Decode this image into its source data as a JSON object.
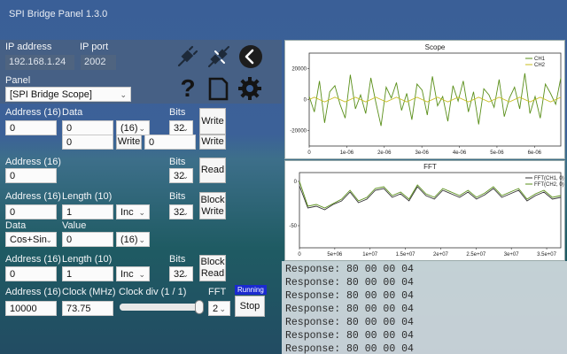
{
  "app": {
    "title": "SPI Bridge Panel 1.3.0"
  },
  "connection": {
    "ip_address_label": "IP address",
    "ip_address_value": "192.168.1.24",
    "ip_port_label": "IP port",
    "ip_port_value": "2002",
    "icons": [
      "plug-disconnected-icon",
      "plug-connect-icon",
      "back-icon"
    ]
  },
  "panel": {
    "label": "Panel",
    "selected": "[SPI Bridge Scope]",
    "icons": [
      "help-icon",
      "document-icon",
      "settings-icon"
    ]
  },
  "write_section": {
    "address_label": "Address (16)",
    "address_value": "0",
    "data_label": "Data",
    "data_value": "0",
    "data_format": "(16)",
    "bits_label": "Bits",
    "bits_value": "32",
    "write_button": "Write",
    "row2_data_value": "0",
    "row2_write_button": "Write",
    "row2_value": "0",
    "row2_write_button2": "Write"
  },
  "read_section": {
    "address_label": "Address (16)",
    "address_value": "0",
    "bits_label": "Bits",
    "bits_value": "32",
    "read_button": "Read"
  },
  "block_write_section": {
    "address_label": "Address (16)",
    "address_value": "0",
    "length_label": "Length (10)",
    "length_value": "1",
    "mode": "Inc",
    "bits_label": "Bits",
    "bits_value": "32",
    "button": "Block Write",
    "data_label": "Data",
    "data_source": "Cos+Sin",
    "value_label": "Value",
    "value_value": "0",
    "value_format": "(16)"
  },
  "block_read_section": {
    "address_label": "Address (16)",
    "address_value": "0",
    "length_label": "Length (10)",
    "length_value": "1",
    "mode": "Inc",
    "bits_label": "Bits",
    "bits_value": "32",
    "button": "Block Read"
  },
  "scope_section": {
    "address_label": "Address (16)",
    "address_value": "10000",
    "clock_label": "Clock (MHz)",
    "clock_value": "73.75",
    "clock_div_label": "Clock div (1 / 1)",
    "clock_div_level": 1.0,
    "fft_label": "FFT",
    "fft_value": "2",
    "status": "Running",
    "stop_button": "Stop"
  },
  "chart_data": [
    {
      "type": "line",
      "title": "Scope",
      "x_ticks": [
        "0",
        "1e-06",
        "2e-06",
        "3e-06",
        "4e-06",
        "5e-06",
        "6e-06"
      ],
      "y_ticks": [
        "20000",
        "0",
        "-20000"
      ],
      "xlim": [
        0,
        6.7e-06
      ],
      "ylim": [
        -30000,
        30000
      ],
      "series": [
        {
          "name": "CH1",
          "color": "#5a8f1a",
          "values": [
            2000,
            -8000,
            12000,
            -15000,
            5000,
            9000,
            -3000,
            -12000,
            16000,
            -6000,
            3000,
            -9000,
            14000,
            -2000,
            -17000,
            8000,
            1000,
            11000,
            -7000,
            4000,
            -13000,
            10000,
            6000,
            -10000,
            15000,
            -4000,
            2000,
            -14000,
            9000,
            -1000,
            12000,
            -8000,
            5000,
            -16000,
            7000,
            3000,
            -5000,
            13000,
            -11000,
            1000,
            8000,
            -6000,
            17000,
            -9000,
            2000,
            -12000,
            10000,
            4000,
            -3000,
            14000
          ]
        },
        {
          "name": "CH2",
          "color": "#c8bd1e",
          "values": [
            0,
            1500,
            0,
            -1500,
            0,
            1500,
            0,
            -1500,
            0,
            1500,
            0,
            -1500,
            0,
            1500,
            0,
            -1500,
            0,
            1500,
            0,
            -1500,
            0,
            1500,
            0,
            -1500,
            0,
            1500,
            0,
            -1500,
            0,
            1500,
            0,
            -1500,
            0,
            1500,
            0,
            -1500,
            0,
            1500,
            0,
            -1500,
            0,
            1500,
            0,
            -1500,
            0,
            1500,
            0,
            -1500,
            0,
            1500
          ]
        }
      ],
      "legend": "top-right"
    },
    {
      "type": "line",
      "title": "FFT",
      "x_ticks": [
        "0",
        "5e+06",
        "1e+07",
        "1.5e+07",
        "2e+07",
        "2.5e+07",
        "3e+07",
        "3.5e+07"
      ],
      "y_ticks": [
        "0",
        "-50"
      ],
      "xlim": [
        0,
        37000000.0
      ],
      "ylim": [
        -75,
        10
      ],
      "series": [
        {
          "name": "FFT(CH1, 0)",
          "color": "#333333",
          "values": [
            -5,
            -30,
            -28,
            -32,
            -26,
            -22,
            -12,
            -24,
            -20,
            -10,
            -8,
            -18,
            -14,
            -22,
            -6,
            -16,
            -20,
            -10,
            -14,
            -18,
            -12,
            -20,
            -15,
            -8,
            -18,
            -14,
            -10,
            -22,
            -16,
            -12,
            -20,
            -18
          ]
        },
        {
          "name": "FFT(CH2, 0)",
          "color": "#5a8f1a",
          "values": [
            0,
            -28,
            -26,
            -30,
            -25,
            -20,
            -10,
            -22,
            -18,
            -8,
            -6,
            -16,
            -12,
            -20,
            -4,
            -14,
            -18,
            -8,
            -12,
            -16,
            -10,
            -18,
            -13,
            -6,
            -16,
            -12,
            -8,
            -20,
            -14,
            -10,
            -18,
            -16
          ]
        }
      ],
      "legend": "top-right"
    }
  ],
  "console": {
    "lines": [
      "Response: 80 00 00 04",
      "Response: 80 00 00 04",
      "Response: 80 00 00 04",
      "Response: 80 00 00 04",
      "Response: 80 00 00 04",
      "Response: 80 00 00 04",
      "Response: 80 00 00 04"
    ]
  }
}
